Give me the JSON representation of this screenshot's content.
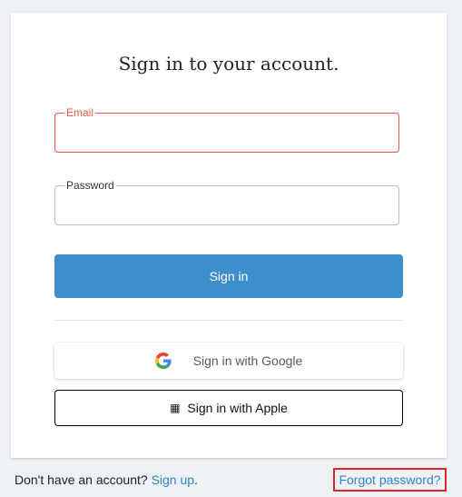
{
  "card": {
    "title": "Sign in to your account."
  },
  "form": {
    "email_label": "Email",
    "email_value": "",
    "password_label": "Password",
    "password_value": "",
    "submit_label": "Sign in"
  },
  "social": {
    "google_label": "Sign in with Google",
    "google_icon": "google-g-icon",
    "apple_label": "Sign in with Apple",
    "apple_icon": "apple-icon"
  },
  "footer": {
    "signup_prompt": "Don't have an account?",
    "signup_link": "Sign up",
    "signup_suffix": ".",
    "forgot_link": "Forgot password?"
  },
  "colors": {
    "primary": "#3d8fcb",
    "error": "#e2583e",
    "link": "#2f86c7",
    "highlight": "#e0222a",
    "page_bg": "#eef1f5"
  }
}
